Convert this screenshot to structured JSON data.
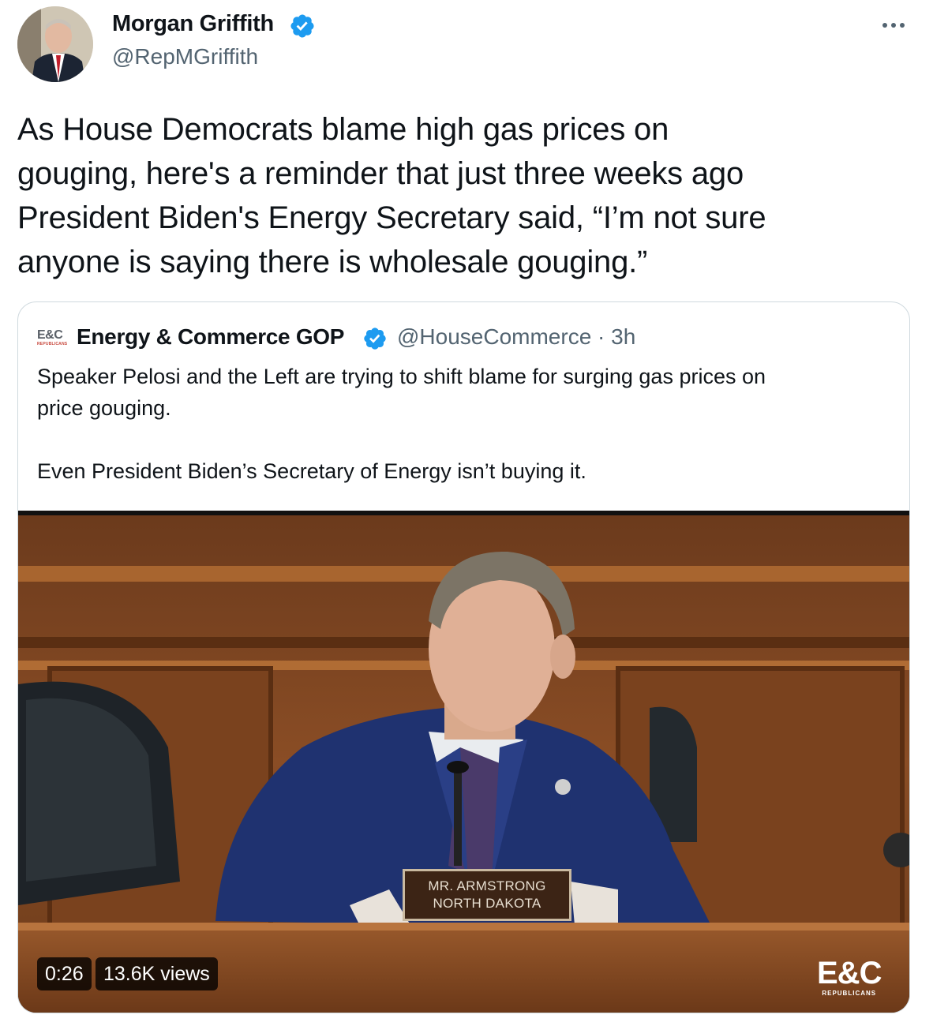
{
  "author": {
    "name": "Morgan Griffith",
    "handle": "@RepMGriffith",
    "verified": true,
    "avatar_icon": "profile-photo"
  },
  "tweet": {
    "text": "As House Democrats blame high gas prices on\ngouging, here's a reminder that just three weeks ago\nPresident Biden's Energy Secretary said, “I’m not sure\nanyone is saying there is wholesale gouging.”"
  },
  "quoted": {
    "logo": "E&C",
    "logo_sub": "REPUBLICANS",
    "name": "Energy & Commerce GOP",
    "verified": true,
    "handle_time": "@HouseCommerce · 3h",
    "text": "Speaker Pelosi and the Left are trying to shift blame for surging gas prices on\nprice gouging.\n\nEven President Biden’s Secretary of Energy isn’t buying it.",
    "video": {
      "duration": "0:26",
      "views": "13.6K views",
      "nameplate_line1": "MR. ARMSTRONG",
      "nameplate_line2": "NORTH DAKOTA",
      "brand": "E&C",
      "brand_sub": "REPUBLICANS"
    }
  },
  "colors": {
    "verified_blue": "#1d9bf0",
    "secondary_text": "#536471",
    "border": "#cfd9de"
  }
}
